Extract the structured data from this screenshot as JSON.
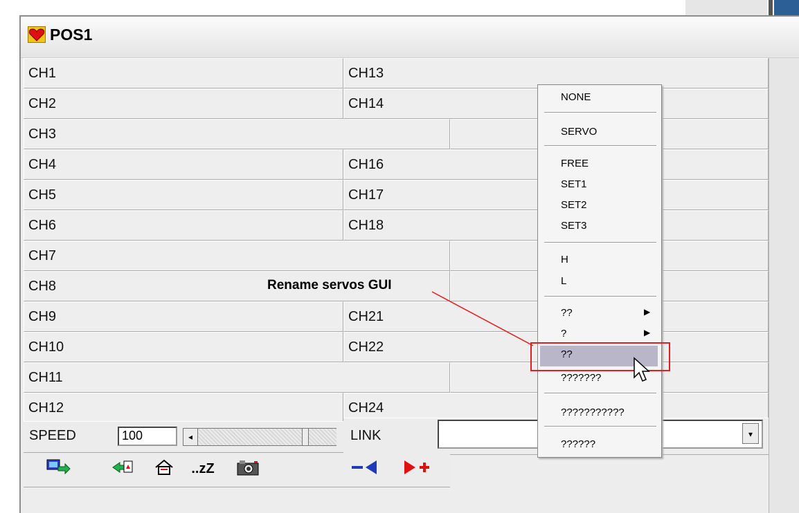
{
  "window": {
    "title": "POS1"
  },
  "left_column": [
    "CH1",
    "CH2",
    "CH3",
    "CH4",
    "CH5",
    "CH6",
    "CH7",
    "CH8",
    "CH9",
    "CH10",
    "CH11",
    "CH12"
  ],
  "right_column": [
    "CH13",
    "CH14",
    "",
    "CH16",
    "CH17",
    "CH18",
    "",
    "",
    "CH21",
    "CH22",
    "",
    "CH24"
  ],
  "speed": {
    "label": "SPEED",
    "value": "100",
    "left_arrow": "◂"
  },
  "link": {
    "label": "LINK",
    "arrow": "▾"
  },
  "toolbar_icons": [
    "monitor-arrow-icon",
    "robot-return-icon",
    "home-icon",
    "sleep-icon",
    "camera-icon",
    "remove-position-icon",
    "add-position-icon"
  ],
  "toolbar_glyphs": {
    "sleep": "..zZ"
  },
  "context_menu": {
    "items": [
      "NONE",
      "SERVO",
      "FREE",
      "SET1",
      "SET2",
      "SET3",
      "H",
      "L",
      "??",
      "?",
      "??",
      "???????",
      "???????????",
      "??????"
    ],
    "submenu_arrow": "▶"
  },
  "annotation": {
    "text": "Rename servos GUI",
    "color": "#e02020"
  }
}
